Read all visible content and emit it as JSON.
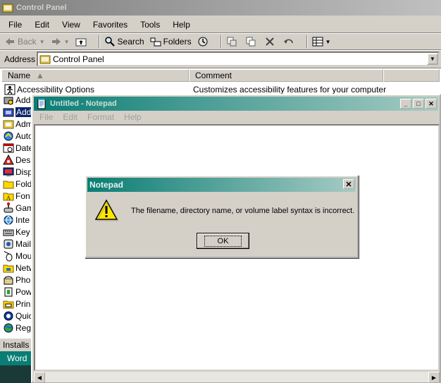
{
  "control_panel": {
    "title": "Control Panel",
    "menu": [
      "File",
      "Edit",
      "View",
      "Favorites",
      "Tools",
      "Help"
    ],
    "toolbar": {
      "back": "Back",
      "search": "Search",
      "folders": "Folders"
    },
    "address": {
      "label": "Address",
      "value": "Control Panel"
    },
    "columns": {
      "name": "Name",
      "comment": "Comment"
    },
    "first_row": {
      "name": "Accessibility Options",
      "comment": "Customizes accessibility features for your computer"
    },
    "visible_items": [
      "Add",
      "Add",
      "Adm",
      "Auto",
      "Date",
      "Des",
      "Disp",
      "Fold",
      "Fon",
      "Gam",
      "Inte",
      "Key",
      "Mail",
      "Mou",
      "Netw",
      "Pho",
      "Pow",
      "Prin",
      "Quic",
      "Reg"
    ],
    "status_text": "Installs"
  },
  "taskbar": {
    "word_button": "Word"
  },
  "notepad": {
    "title": "Untitled - Notepad",
    "menu": [
      "File",
      "Edit",
      "Format",
      "Help"
    ]
  },
  "dialog": {
    "title": "Notepad",
    "message": "The filename, directory name, or volume label syntax is incorrect.",
    "ok_label": "OK"
  },
  "colors": {
    "active_title": "#0a7d74",
    "selection": "#0a246a",
    "window_face": "#d4d0c8"
  }
}
